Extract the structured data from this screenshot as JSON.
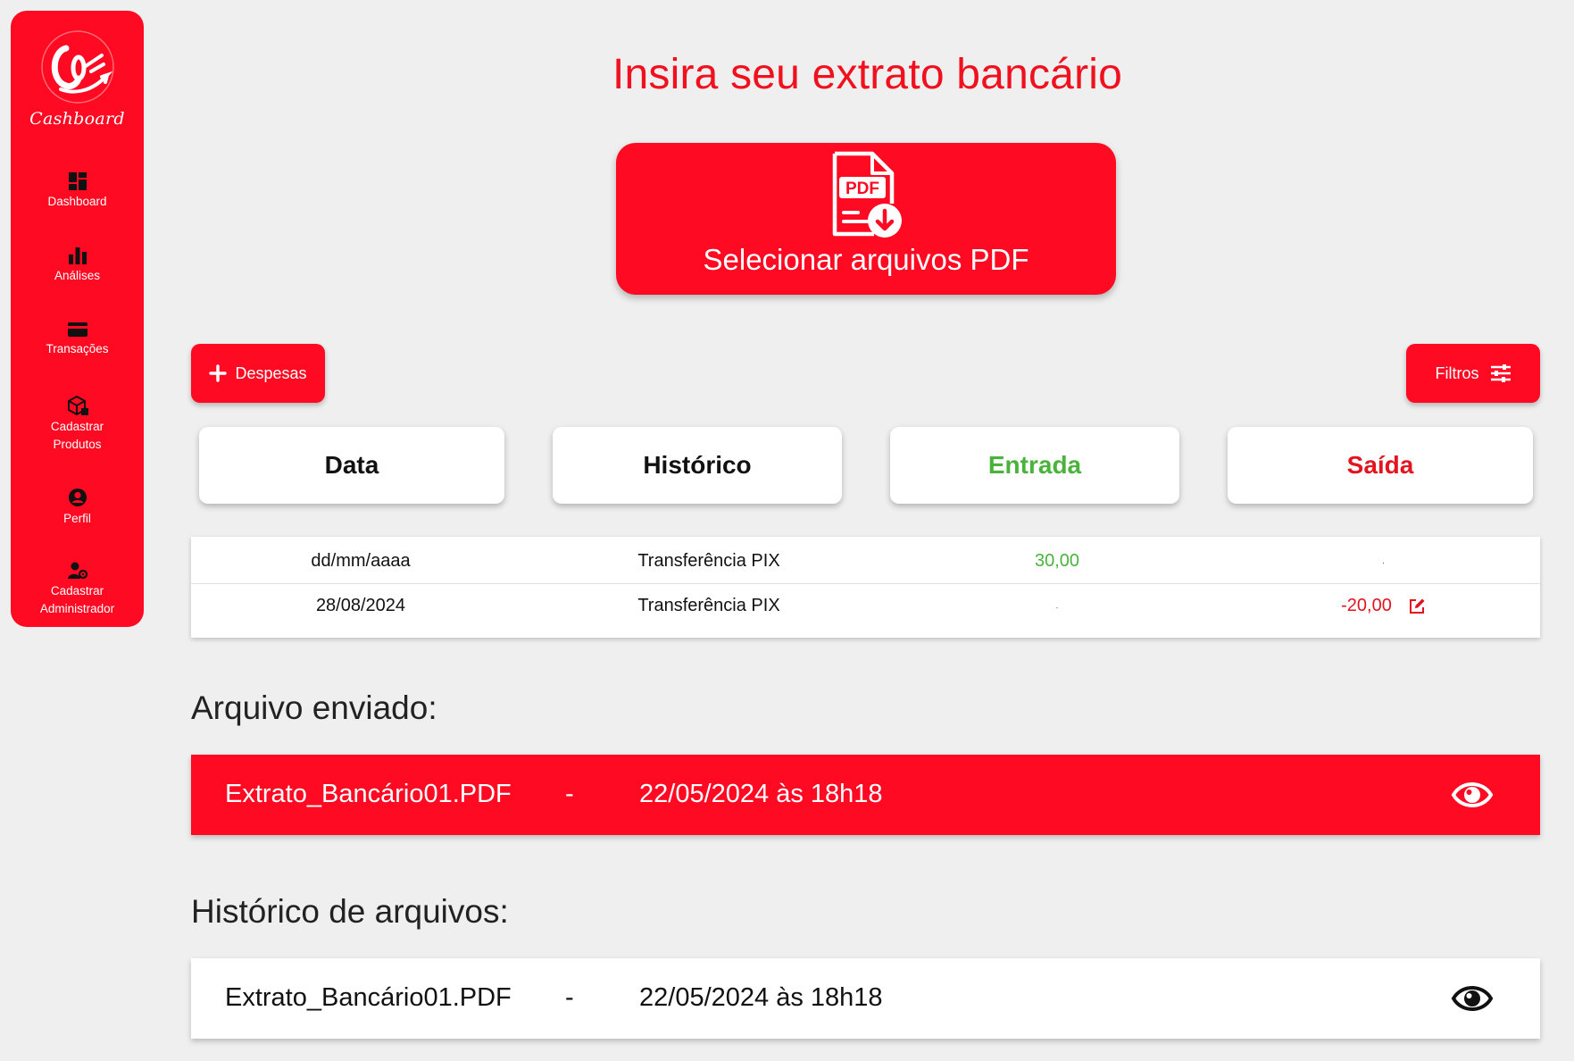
{
  "app": {
    "logo_text": "Cashboard"
  },
  "sidebar": {
    "items": [
      {
        "label": "Dashboard",
        "icon": "dashboard-icon"
      },
      {
        "label": "Análises",
        "icon": "bar-chart-icon"
      },
      {
        "label": "Transações",
        "icon": "credit-card-icon"
      },
      {
        "label_line1": "Cadastrar",
        "label_line2": "Produtos",
        "icon": "box-icon"
      },
      {
        "label": "Perfil",
        "icon": "user-circle-icon"
      },
      {
        "label_line1": "Cadastrar",
        "label_line2": "Administrador",
        "icon": "admin-user-icon"
      }
    ]
  },
  "main": {
    "title": "Insira seu extrato bancário",
    "upload_label": "Selecionar arquivos PDF",
    "upload_icon_text": "PDF",
    "despesas_label": "Despesas",
    "filtros_label": "Filtros",
    "columns": {
      "data": "Data",
      "historico": "Histórico",
      "entrada": "Entrada",
      "saida": "Saída"
    },
    "rows": [
      {
        "data": "dd/mm/aaaa",
        "historico": "Transferência PIX",
        "entrada": "30,00",
        "saida": "."
      },
      {
        "data": "28/08/2024",
        "historico": "Transferência PIX",
        "entrada": ".",
        "saida": "-20,00"
      }
    ],
    "arquivo_enviado": {
      "title": "Arquivo enviado:",
      "filename": "Extrato_Bancário01.PDF",
      "separator": "-",
      "datetime": "22/05/2024 às 18h18"
    },
    "historico_arquivos": {
      "title": "Histórico de arquivos:",
      "filename": "Extrato_Bancário01.PDF",
      "separator": "-",
      "datetime": "22/05/2024 às 18h18"
    }
  },
  "colors": {
    "brand_red": "#ff0a22",
    "entrada_green": "#4ab33c",
    "saida_red": "#e1141f",
    "background": "#efefef"
  }
}
